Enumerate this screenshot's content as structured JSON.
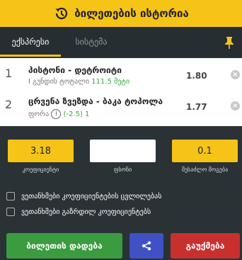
{
  "header": {
    "title": "ბილეთების ისტორია",
    "icon": "history-icon"
  },
  "tabs": [
    {
      "label": "ექსპრესი",
      "active": true
    },
    {
      "label": "სისტემა",
      "active": false
    }
  ],
  "pin_icon": "pin-icon",
  "bets": [
    {
      "num": "1",
      "teams": "პისტონი - დეტროიტი",
      "market": "I გუნდის ტოტალი",
      "selection": "111.5 მეტი",
      "odd": "1.80"
    },
    {
      "num": "2",
      "teams": "ცრვენა ზვეზდა - ბაკა ტოპოლა",
      "market": "ფორა",
      "info": "i",
      "selection": "(-2.5) 1",
      "odd": "1.77"
    }
  ],
  "fields": {
    "coef_value": "3.18",
    "coef_label": "კოეფიციენტი",
    "stake_value": "",
    "stake_label": "ფსონი",
    "win_value": "0.1",
    "win_label": "შესაძლო მოგება"
  },
  "checkboxes": [
    {
      "label": "ვეთანხმები კოეფიციენტების ცვლილებას",
      "checked": false
    },
    {
      "label": "ვეთანხმები გაზრდილ კოეფიციენტებს",
      "checked": false
    }
  ],
  "buttons": {
    "place": "ბილეთის დადება",
    "share_icon": "share-icon",
    "cancel": "გაუქმება"
  },
  "colors": {
    "accent": "#f5c417",
    "background": "#2a3236",
    "place": "#3a9b3f",
    "share": "#3f51c4",
    "cancel": "#c8302e"
  }
}
